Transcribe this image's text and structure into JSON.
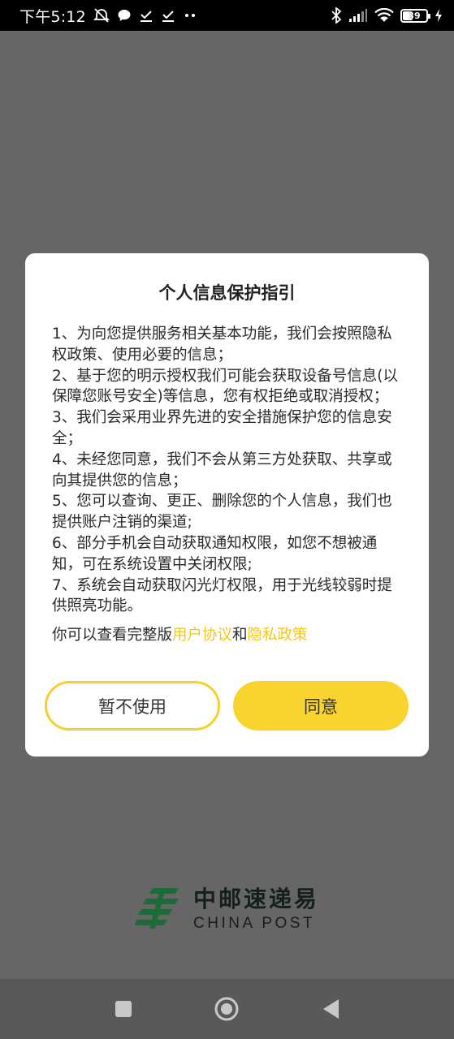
{
  "status_bar": {
    "time": "下午5:12",
    "battery_level": "39",
    "icons": [
      "alarm-off-icon",
      "chat-bubble-icon",
      "download-done-icon",
      "download-done-icon",
      "more-dots-icon",
      "bluetooth-icon",
      "signal-icon",
      "wifi-icon",
      "battery-icon",
      "charging-icon"
    ]
  },
  "dialog": {
    "title": "个人信息保护指引",
    "paragraphs": [
      "1、为向您提供服务相关基本功能，我们会按照隐私权政策、使用必要的信息；",
      "2、基于您的明示授权我们可能会获取设备号信息(以保障您账号安全)等信息，您有权拒绝或取消授权；",
      "3、我们会采用业界先进的安全措施保护您的信息安全；",
      "4、未经您同意，我们不会从第三方处获取、共享或向其提供您的信息；",
      "5、您可以查询、更正、删除您的个人信息，我们也提供账户注销的渠道;",
      "6、部分手机会自动获取通知权限，如您不想被通知，可在系统设置中关闭权限;",
      "7、系统会自动获取闪光灯权限，用于光线较弱时提供照亮功能。"
    ],
    "footer_prefix": "你可以查看完整版",
    "user_agreement_link": "用户协议",
    "conjunction": "和",
    "privacy_policy_link": "隐私政策",
    "decline_label": "暂不使用",
    "agree_label": "同意"
  },
  "logo": {
    "name_cn": "中邮速递易",
    "name_en": "CHINA POST"
  },
  "colors": {
    "accent": "#f9d42e",
    "link": "#f2c81c",
    "overlay": "#666666",
    "logo_green": "#1e6b3a"
  }
}
